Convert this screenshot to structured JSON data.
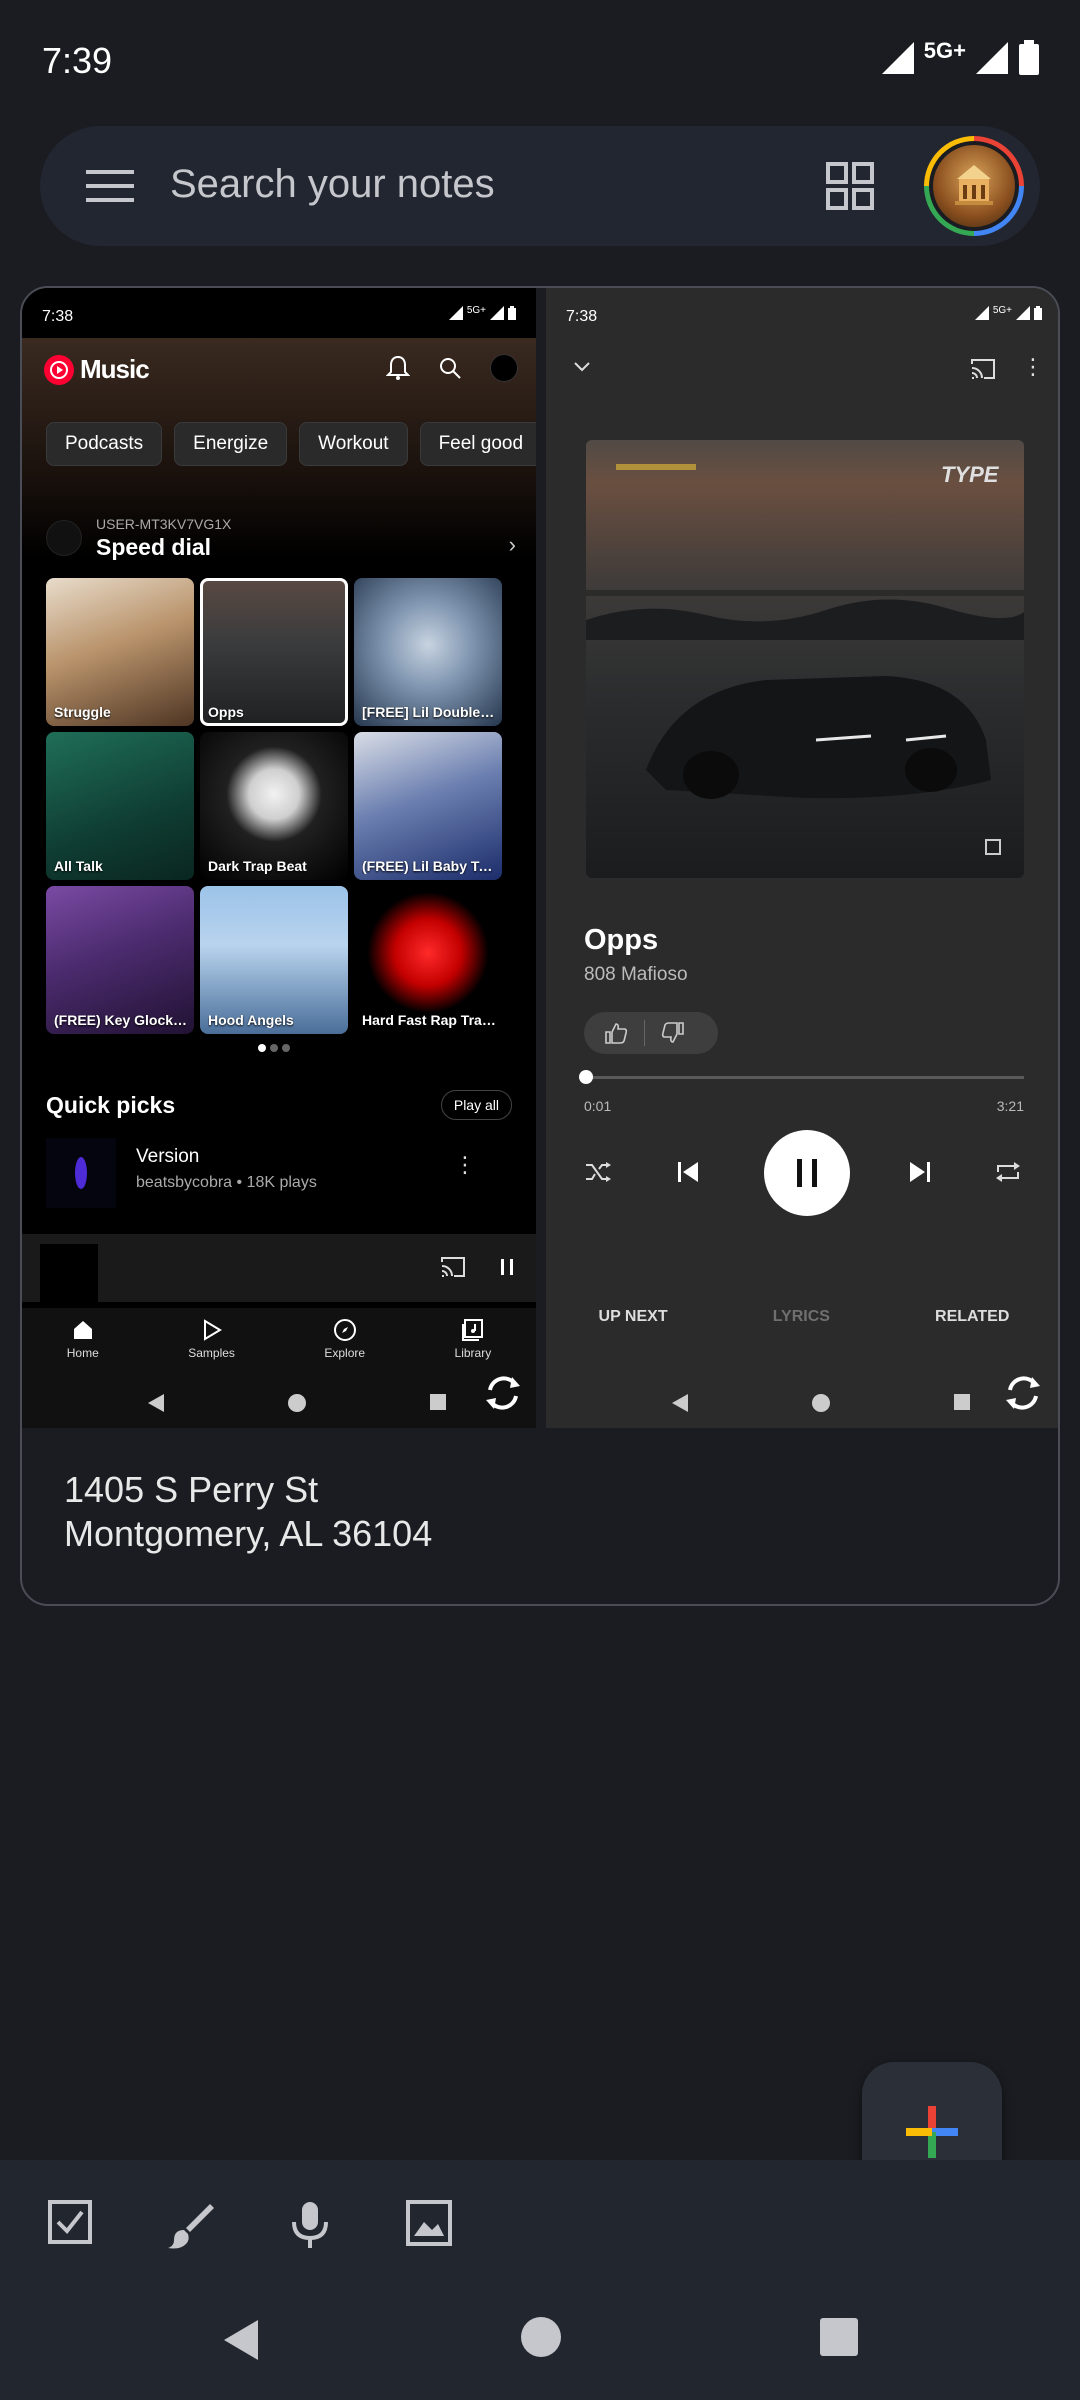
{
  "status": {
    "time": "7:39",
    "network": "5G+"
  },
  "search": {
    "placeholder": "Search your notes"
  },
  "note": {
    "address_line1": "1405 S Perry St",
    "address_line2": "Montgomery, AL 36104",
    "left_screenshot": {
      "time": "7:38",
      "network": "5G+",
      "app_name": "Music",
      "chips": [
        "Podcasts",
        "Energize",
        "Workout",
        "Feel good"
      ],
      "speed_dial": {
        "user": "USER-MT3KV7VG1X",
        "title": "Speed dial"
      },
      "tiles": [
        "Struggle",
        "Opps",
        "[FREE] Lil Double 0...",
        "All Talk",
        "Dark Trap Beat",
        "(FREE) Lil Baby Typ...",
        "(FREE) Key Glock x...",
        "Hood Angels",
        "Hard Fast Rap Trap..."
      ],
      "quick_picks": {
        "title": "Quick picks",
        "play_all": "Play all"
      },
      "track": {
        "title": "Version",
        "subtitle": "beatsbycobra • 18K plays"
      },
      "nav": {
        "home": "Home",
        "samples": "Samples",
        "explore": "Explore",
        "library": "Library"
      }
    },
    "right_screenshot": {
      "time": "7:38",
      "network": "5G+",
      "song_title": "Opps",
      "artist": "808 Mafioso",
      "time_current": "0:01",
      "time_total": "3:21",
      "progress_fraction": 0.005,
      "tabs": {
        "up_next": "UP NEXT",
        "lyrics": "LYRICS",
        "related": "RELATED"
      }
    }
  },
  "colors": {
    "background": "#1a1c21",
    "search_bg": "#222630",
    "youtube_red": "#ff0033"
  }
}
